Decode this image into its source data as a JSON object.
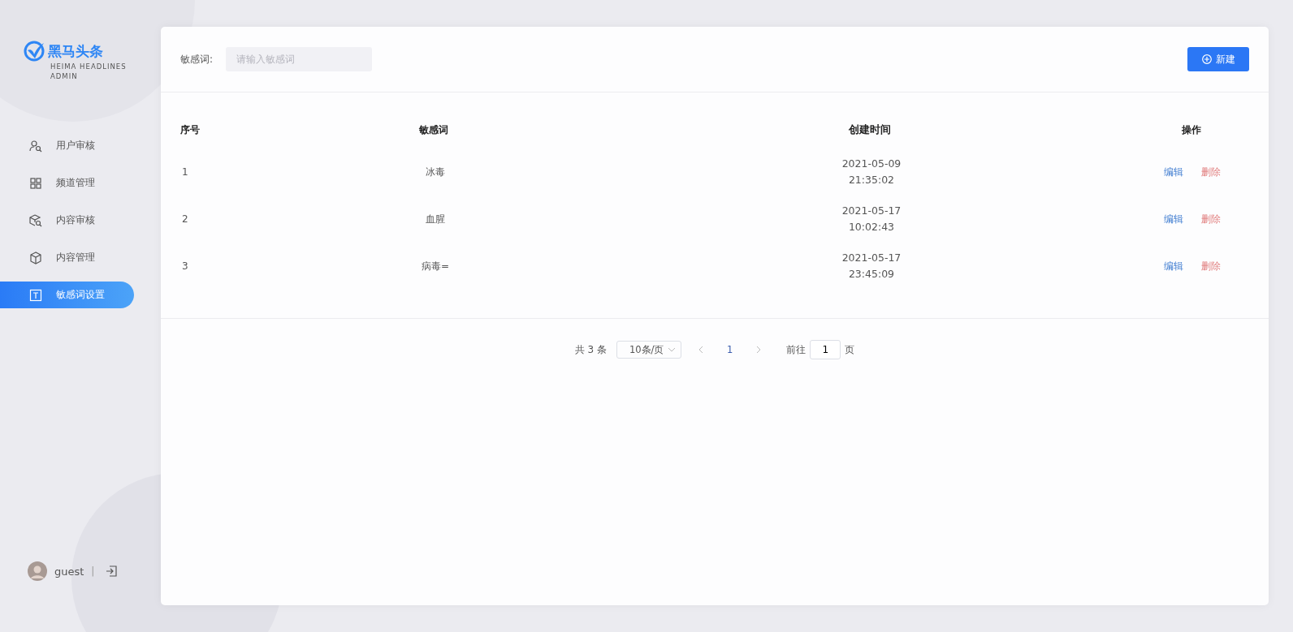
{
  "brand": {
    "name": "黑马头条",
    "subtitle": "HEIMA HEADLINES ADMIN"
  },
  "sidebar": {
    "items": [
      {
        "label": "用户审核",
        "kind": "user",
        "selected": false
      },
      {
        "label": "频道管理",
        "kind": "grid",
        "selected": false
      },
      {
        "label": "内容审核",
        "kind": "cube-search",
        "selected": false
      },
      {
        "label": "内容管理",
        "kind": "cube",
        "selected": false
      },
      {
        "label": "敏感词设置",
        "kind": "text",
        "selected": true
      }
    ]
  },
  "user": {
    "name": "guest",
    "separator": "|"
  },
  "filter": {
    "label": "敏感词:",
    "placeholder": "请输入敏感词"
  },
  "new_button": {
    "label": "新建"
  },
  "table": {
    "columns": [
      "序号",
      "敏感词",
      "创建时间",
      "操作"
    ],
    "rows": [
      {
        "index": "1",
        "word": "冰毒",
        "date": "2021-05-09",
        "time": "21:35:02",
        "actions": [
          "编辑",
          "删除"
        ]
      },
      {
        "index": "2",
        "word": "血腥",
        "date": "2021-05-17",
        "time": "10:02:43",
        "actions": [
          "编辑",
          "删除"
        ]
      },
      {
        "index": "3",
        "word": "病毒=",
        "date": "2021-05-17",
        "time": "23:45:09",
        "actions": [
          "编辑",
          "删除"
        ]
      }
    ]
  },
  "pagination": {
    "total": "共 3 条",
    "page_size": "10条/页",
    "pages": [
      {
        "label": "1",
        "selected": true
      }
    ],
    "goto_label": "前往",
    "goto_value": "1",
    "goto_suffix": "页"
  }
}
